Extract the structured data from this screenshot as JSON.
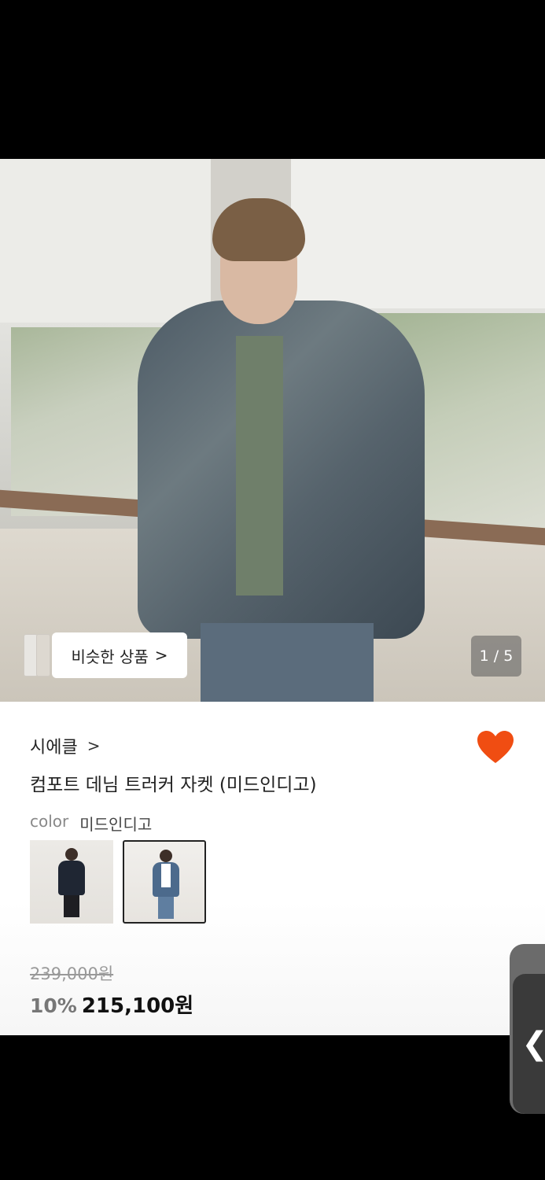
{
  "gallery": {
    "similar_label": "비슷한 상품",
    "similar_arrow": ">",
    "counter": "1 / 5"
  },
  "product": {
    "brand": "시에클",
    "brand_chevron": ">",
    "title": "컴포트 데님 트러커 자켓 (미드인디고)",
    "color_label": "color",
    "color_value": "미드인디고",
    "swatches": [
      "dark-navy-jacket",
      "mid-indigo-jacket"
    ],
    "selected_swatch": 1,
    "original_price": "239,000원",
    "discount": "10%",
    "price": "215,100원"
  },
  "side_handle": {
    "glyph": "❮"
  },
  "colors": {
    "heart": "#f04d12",
    "background": "#000000"
  },
  "icons": {
    "heart": "heart-icon",
    "side": "chevron-left-icon"
  }
}
